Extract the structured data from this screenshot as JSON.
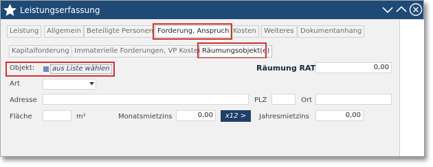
{
  "window": {
    "title": "Leistungserfassung"
  },
  "tabs_main": [
    {
      "label": "Leistung"
    },
    {
      "label": "Allgemein"
    },
    {
      "label": "Beteiligte Personen"
    },
    {
      "label": "Forderung, Anspruch"
    },
    {
      "label": "Kosten"
    },
    {
      "label": "Weiteres"
    },
    {
      "label": "Dokumentanhang"
    }
  ],
  "tabs_sub": [
    {
      "label": "Kapitalforderung"
    },
    {
      "label": "Immaterielle Forderungen, VP Kosten"
    },
    {
      "label": "Räumungsobjekt(e)"
    }
  ],
  "form": {
    "objekt_label": "Objekt:",
    "objekt_link": "aus Liste wählen",
    "raeumung_label": "Räumung RATG",
    "raeumung_value": "0,00",
    "art_label": "Art",
    "art_value": "",
    "adresse_label": "Adresse",
    "adresse_value": "",
    "plz_label": "PLZ",
    "plz_value": "",
    "ort_label": "Ort",
    "ort_value": "",
    "flaeche_label": "Fläche",
    "flaeche_value": "",
    "flaeche_unit": "m²",
    "monatsmietzins_label": "Monatsmietzins",
    "monatsmietzins_value": "0,00",
    "calc_button": "x12 >",
    "jahresmietzins_label": "Jahresmietzins",
    "jahresmietzins_value": "0,00"
  },
  "colors": {
    "titlebar": "#1f4a76",
    "highlight": "#d0312d",
    "calc_button": "#1f3f66"
  },
  "icons": {
    "app": "star-icon",
    "collapse": "chevron-down-icon",
    "expand": "chevron-up-icon",
    "close": "close-icon",
    "dropdown": "caret-down-icon"
  }
}
